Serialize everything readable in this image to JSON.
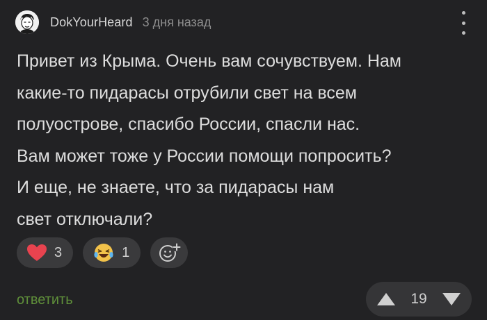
{
  "comment": {
    "author": "DokYourHeard",
    "timestamp": "3 дня назад",
    "lines": [
      "Привет из Крыма. Очень вам сочувствуем. Нам",
      "какие-то пидарасы отрубили свет на всем",
      "полуострове, спасибо России, спасли нас.",
      "Вам может тоже у России помощи попросить?",
      "И еще, не знаете, что за пидарасы нам",
      "свет отключали?"
    ]
  },
  "reactions": [
    {
      "icon": "heart-icon",
      "count": "3",
      "color": "#e8434f"
    },
    {
      "icon": "laughing-emoji-icon",
      "count": "1",
      "color": "#f2c24a"
    }
  ],
  "actions": {
    "reply_label": "ответить",
    "reply_color": "#5f8f3a"
  },
  "votes": {
    "score": "19"
  },
  "colors": {
    "background": "#222224",
    "pill": "#3a3a3c"
  }
}
